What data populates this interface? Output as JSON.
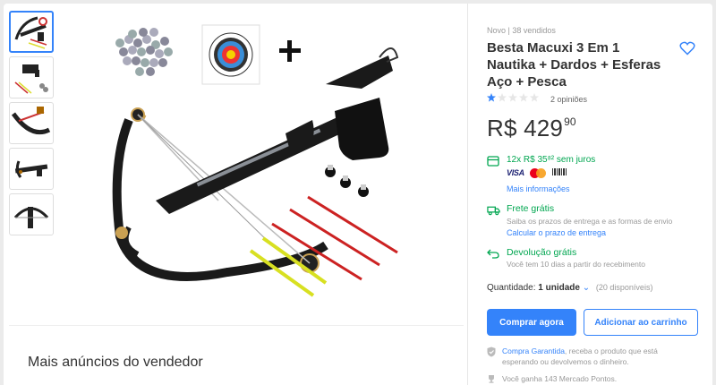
{
  "gallery": {
    "thumbnails": [
      "crossbow-kit-thumb",
      "crossbow-parts-thumb",
      "crossbow-detail-thumb",
      "crossbow-side-thumb",
      "crossbow-front-thumb"
    ]
  },
  "seller_section": {
    "title": "Mais anúncios do vendedor"
  },
  "product": {
    "condition": "Novo",
    "separator": "  |  ",
    "sold": "38 vendidos",
    "title": "Besta Macuxi 3 Em 1 Nautika + Dardos + Esferas Aço + Pesca",
    "rating": {
      "stars_filled": 1,
      "stars_total": 5,
      "reviews_label": "2 opiniões"
    },
    "price": {
      "currency": "R$",
      "integer": "429",
      "cents": "90"
    },
    "installments": "12x R$ 35⁸² sem juros",
    "payment_brands": {
      "visa": "VISA",
      "boleto_icon": "boleto-icon",
      "mastercard_icon": "mastercard-icon"
    },
    "more_info": "Mais informações"
  },
  "shipping": {
    "title": "Frete grátis",
    "subtitle": "Saiba os prazos de entrega e as formas de envio",
    "link": "Calcular o prazo de entrega"
  },
  "returns": {
    "title": "Devolução grátis",
    "subtitle": "Você tem 10 dias a partir do recebimento"
  },
  "quantity": {
    "label": "Quantidade: ",
    "value": "1 unidade",
    "available": "(20 disponíveis)"
  },
  "buttons": {
    "buy": "Comprar agora",
    "cart": "Adicionar ao carrinho"
  },
  "guarantee": {
    "link": "Compra Garantida",
    "text": ", receba o produto que está esperando ou devolvemos o dinheiro."
  },
  "points": "Você ganha 143 Mercado Pontos.",
  "colors": {
    "accent": "#3483fa",
    "success": "#00a650"
  }
}
